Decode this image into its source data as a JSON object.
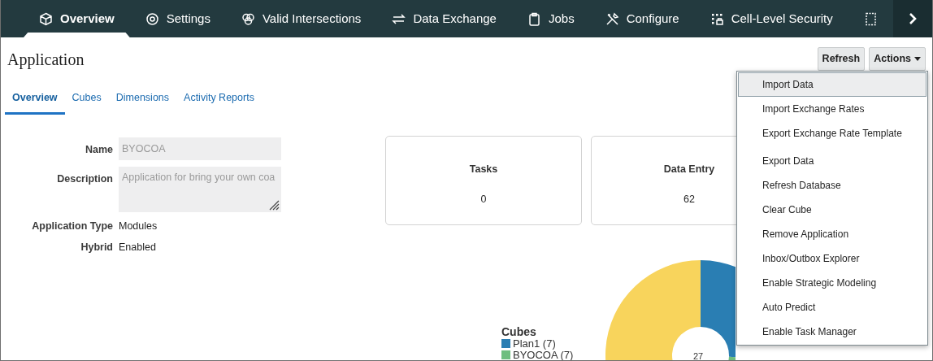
{
  "nav": {
    "items": [
      {
        "label": "Overview",
        "kind": "cube",
        "selected": true
      },
      {
        "label": "Settings",
        "kind": "gear",
        "selected": false
      },
      {
        "label": "Valid Intersections",
        "kind": "circles",
        "selected": false
      },
      {
        "label": "Data Exchange",
        "kind": "arrows",
        "selected": false
      },
      {
        "label": "Jobs",
        "kind": "clipboard",
        "selected": false
      },
      {
        "label": "Configure",
        "kind": "tools",
        "selected": false
      },
      {
        "label": "Cell-Level Security",
        "kind": "grid",
        "selected": false
      },
      {
        "kind": "doc",
        "selected": false
      }
    ]
  },
  "page": {
    "title": "Application",
    "buttons": [
      {
        "label": "Refresh",
        "kind": "plain"
      },
      {
        "label": "Actions",
        "kind": "menu"
      }
    ]
  },
  "tabs": [
    {
      "label": "Overview",
      "selected": true
    },
    {
      "label": "Cubes",
      "selected": false
    },
    {
      "label": "Dimensions",
      "selected": false
    },
    {
      "label": "Activity Reports",
      "selected": false
    }
  ],
  "form": [
    {
      "label": "Name",
      "kind": "input",
      "value": "BYOCOA",
      "disabled": true
    },
    {
      "label": "Description",
      "kind": "textarea",
      "placeholder": "Application for bring your own coa",
      "disabled": true
    },
    {
      "label": "Application Type",
      "kind": "text",
      "value": "Modules"
    },
    {
      "label": "Hybrid",
      "kind": "text",
      "value": "Enabled"
    }
  ],
  "cards": [
    {
      "title": "Tasks",
      "value": "0"
    },
    {
      "title": "Data Entry",
      "value": "62"
    }
  ],
  "chart": {
    "legend_title": "Cubes",
    "center_label": "27",
    "legend": [
      {
        "label": "Plan1 (7)",
        "color": "#2a7eb3"
      },
      {
        "label": "BYOCOA (7)",
        "color": "#6ebe7f"
      }
    ]
  },
  "menu": {
    "items": [
      {
        "label": "Import Data",
        "selected": true,
        "separator_before": false
      },
      {
        "label": "Import Exchange Rates",
        "selected": false,
        "separator_before": false
      },
      {
        "label": "Export Exchange Rate Template",
        "selected": false,
        "separator_before": false
      },
      {
        "label": "Export Data",
        "selected": false,
        "separator_before": true
      },
      {
        "label": "Refresh Database",
        "selected": false,
        "separator_before": false
      },
      {
        "label": "Clear Cube",
        "selected": false,
        "separator_before": false
      },
      {
        "label": "Remove Application",
        "selected": false,
        "separator_before": false
      },
      {
        "label": "Inbox/Outbox Explorer",
        "selected": false,
        "separator_before": false
      },
      {
        "label": "Enable Strategic Modeling",
        "selected": false,
        "separator_before": false
      },
      {
        "label": "Auto Predict",
        "selected": false,
        "separator_before": false
      },
      {
        "label": "Enable Task Manager",
        "selected": false,
        "separator_before": false
      }
    ]
  }
}
